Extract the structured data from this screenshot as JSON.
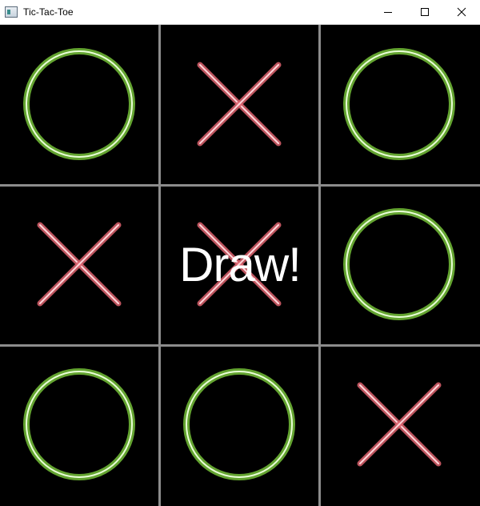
{
  "window": {
    "title": "Tic-Tac-Toe"
  },
  "titlebar_icons": {
    "app": "app-window-icon",
    "minimize": "minimize-icon",
    "maximize": "maximize-icon",
    "close": "close-icon"
  },
  "board": {
    "cells": [
      "O",
      "X",
      "O",
      "X",
      "X",
      "O",
      "O",
      "O",
      "X"
    ],
    "grid_color": "#8c8c8c",
    "x_color": "#e06470",
    "o_color": "#7ccc3c"
  },
  "status": {
    "text": "Draw!"
  }
}
